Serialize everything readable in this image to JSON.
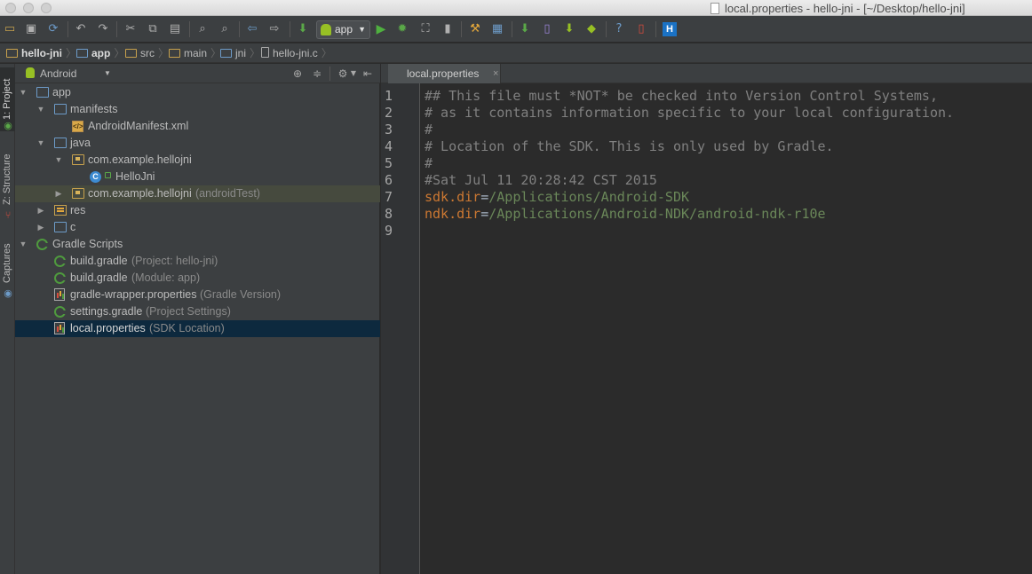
{
  "window": {
    "title": "local.properties - hello-jni - [~/Desktop/hello-jni]"
  },
  "toolbar": {
    "run_config": "app",
    "help_glyph": "?",
    "hierarchy_label": "H"
  },
  "breadcrumbs": [
    {
      "label": "hello-jni",
      "icon": "project-folder-icon"
    },
    {
      "label": "app",
      "icon": "module-folder-icon"
    },
    {
      "label": "src",
      "icon": "folder-icon"
    },
    {
      "label": "main",
      "icon": "folder-icon"
    },
    {
      "label": "jni",
      "icon": "source-folder-icon"
    },
    {
      "label": "hello-jni.c",
      "icon": "c-file-icon"
    }
  ],
  "side_tabs": {
    "project": "1: Project",
    "structure": "Z: Structure",
    "captures": "Captures"
  },
  "project_panel": {
    "view_mode": "Android",
    "tree": [
      {
        "label": "app",
        "hint": "",
        "depth": 0,
        "expanded": true,
        "icon": "module-folder-icon"
      },
      {
        "label": "manifests",
        "hint": "",
        "depth": 1,
        "expanded": true,
        "icon": "folder-icon"
      },
      {
        "label": "AndroidManifest.xml",
        "hint": "",
        "depth": 2,
        "expanded": null,
        "icon": "xml-file-icon"
      },
      {
        "label": "java",
        "hint": "",
        "depth": 1,
        "expanded": true,
        "icon": "source-folder-icon"
      },
      {
        "label": "com.example.hellojni",
        "hint": "",
        "depth": 2,
        "expanded": true,
        "icon": "package-icon"
      },
      {
        "label": "HelloJni",
        "hint": "",
        "depth": 3,
        "expanded": null,
        "icon": "class-icon"
      },
      {
        "label": "com.example.hellojni",
        "hint": "(androidTest)",
        "depth": 2,
        "expanded": false,
        "icon": "package-icon"
      },
      {
        "label": "res",
        "hint": "",
        "depth": 1,
        "expanded": false,
        "icon": "resources-folder-icon"
      },
      {
        "label": "c",
        "hint": "",
        "depth": 1,
        "expanded": false,
        "icon": "source-folder-icon"
      },
      {
        "label": "Gradle Scripts",
        "hint": "",
        "depth": 0,
        "expanded": true,
        "icon": "gradle-icon"
      },
      {
        "label": "build.gradle",
        "hint": "(Project: hello-jni)",
        "depth": 1,
        "expanded": null,
        "icon": "gradle-icon"
      },
      {
        "label": "build.gradle",
        "hint": "(Module: app)",
        "depth": 1,
        "expanded": null,
        "icon": "gradle-icon"
      },
      {
        "label": "gradle-wrapper.properties",
        "hint": "(Gradle Version)",
        "depth": 1,
        "expanded": null,
        "icon": "properties-file-icon"
      },
      {
        "label": "settings.gradle",
        "hint": "(Project Settings)",
        "depth": 1,
        "expanded": null,
        "icon": "gradle-icon"
      },
      {
        "label": "local.properties",
        "hint": "(SDK Location)",
        "depth": 1,
        "expanded": null,
        "icon": "properties-file-icon",
        "selected": true
      }
    ]
  },
  "editor": {
    "tab_label": "local.properties",
    "tab_close": "×",
    "lines": [
      {
        "n": "1",
        "text": "## This file must *NOT* be checked into Version Control Systems,",
        "kind": "comment"
      },
      {
        "n": "2",
        "text": "# as it contains information specific to your local configuration.",
        "kind": "comment"
      },
      {
        "n": "3",
        "text": "#",
        "kind": "comment"
      },
      {
        "n": "4",
        "text": "# Location of the SDK. This is only used by Gradle.",
        "kind": "comment"
      },
      {
        "n": "5",
        "text": "#",
        "kind": "comment"
      },
      {
        "n": "6",
        "text": "#Sat Jul 11 20:28:42 CST 2015",
        "kind": "comment"
      },
      {
        "n": "7",
        "key": "sdk.dir",
        "eq": "=",
        "value": "/Applications/Android-SDK",
        "kind": "property"
      },
      {
        "n": "8",
        "key": "ndk.dir",
        "eq": "=",
        "value": "/Applications/Android-NDK/android-ndk-r10e",
        "kind": "property"
      },
      {
        "n": "9",
        "text": "",
        "kind": "empty"
      }
    ]
  },
  "colors": {
    "comment": "#808080",
    "key": "#cc7832",
    "value": "#6a8759",
    "selection": "#0d293e"
  }
}
